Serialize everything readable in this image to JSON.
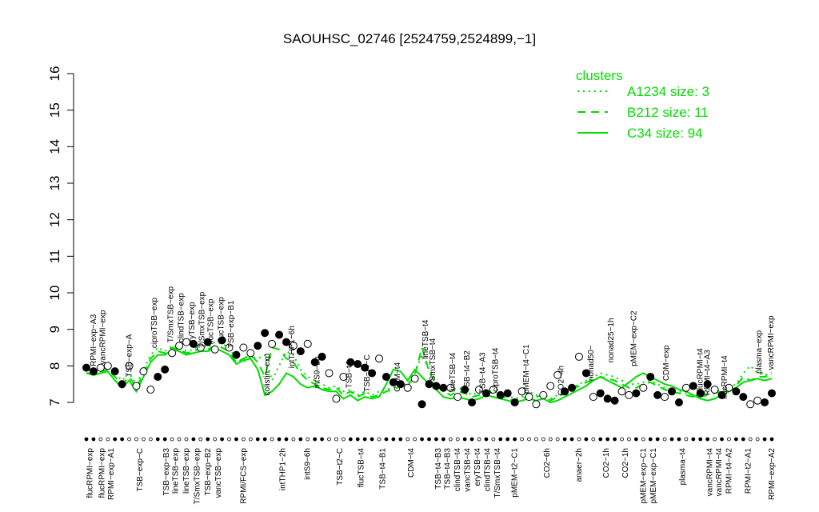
{
  "chart_data": {
    "type": "line",
    "title": "SAOUHSC_02746 [2524759,2524899,−1]",
    "ylim": [
      6.9,
      16.2
    ],
    "yticks": [
      7,
      8,
      9,
      10,
      11,
      12,
      13,
      14,
      15,
      16
    ],
    "legend": {
      "title": "clusters",
      "placement": "top-right",
      "color": "#00dd00",
      "entries": [
        {
          "label": "A1234 size: 3",
          "style": "dotted"
        },
        {
          "label": "B212 size: 11",
          "style": "dashed"
        },
        {
          "label": "C34 size: 94",
          "style": "solid"
        }
      ]
    },
    "x_labels": [
      {
        "pos": 0.5,
        "text": "flucRPMI−exp"
      },
      {
        "pos": 2.2,
        "text": "flucRPMI−exp"
      },
      {
        "pos": 3.5,
        "text": "RPMI−exp−A1"
      },
      {
        "pos": 7.5,
        "text": "TSB−exp−C"
      },
      {
        "pos": 11.2,
        "text": "TSB−exp−B3"
      },
      {
        "pos": 12.5,
        "text": "lineTSB−exp"
      },
      {
        "pos": 14,
        "text": "lineTSB−exp"
      },
      {
        "pos": 15.5,
        "text": "T/SmxTSB−exp"
      },
      {
        "pos": 17,
        "text": "TSB−exp−B2"
      },
      {
        "pos": 18.5,
        "text": "vancTSB−exp"
      },
      {
        "pos": 22,
        "text": "RPMI/FCS−exp"
      },
      {
        "pos": 27.5,
        "text": "intTHP1−2h"
      },
      {
        "pos": 31,
        "text": "intS9−6h"
      },
      {
        "pos": 35.5,
        "text": "TSB−t2−C"
      },
      {
        "pos": 38.5,
        "text": "flucTSB−t4"
      },
      {
        "pos": 41.5,
        "text": "TSB−t4−B1"
      },
      {
        "pos": 45.5,
        "text": "CDM−t4"
      },
      {
        "pos": 49.3,
        "text": "TSB−t4−B3"
      },
      {
        "pos": 50.6,
        "text": "TSB−t4−B3"
      },
      {
        "pos": 52,
        "text": "clindTSB−t4"
      },
      {
        "pos": 53.4,
        "text": "vancTSB−t4"
      },
      {
        "pos": 54.8,
        "text": "eryTSB−t4"
      },
      {
        "pos": 56.2,
        "text": "clindTSB−t4"
      },
      {
        "pos": 57.6,
        "text": "T/SmxTSB−t4"
      },
      {
        "pos": 60,
        "text": "pMEM−t2−C1"
      },
      {
        "pos": 64.5,
        "text": "CO2−6h"
      },
      {
        "pos": 69,
        "text": "anaer−2h"
      },
      {
        "pos": 72.8,
        "text": "CO2−1h"
      },
      {
        "pos": 75.5,
        "text": "CO2−1h"
      },
      {
        "pos": 78,
        "text": "pMEM−exp−C1"
      },
      {
        "pos": 79.4,
        "text": "pMEM−exp−C1"
      },
      {
        "pos": 83.5,
        "text": "plasma−t4"
      },
      {
        "pos": 87.3,
        "text": "vancRPMI−t4"
      },
      {
        "pos": 88.6,
        "text": "vancRPMI−t4"
      },
      {
        "pos": 90,
        "text": "RPMI−t4−A2"
      },
      {
        "pos": 92.7,
        "text": "RPMI−t2−A1"
      },
      {
        "pos": 96,
        "text": "RPMI−exp−A2"
      }
    ],
    "point_labels": [
      {
        "pos": 1,
        "y": 7.9,
        "text": "RPMI−exp−A3"
      },
      {
        "pos": 2.3,
        "y": 7.95,
        "text": "vancRPMI−exp"
      },
      {
        "pos": 6,
        "y": 7.6,
        "text": "TSB−exp−A"
      },
      {
        "pos": 9.5,
        "y": 8.4,
        "text": "ciproTSB−exp"
      },
      {
        "pos": 11.8,
        "y": 8.55,
        "text": "T/SmxTSB−exp"
      },
      {
        "pos": 13.3,
        "y": 8.55,
        "text": "clindTSB−exp"
      },
      {
        "pos": 14.8,
        "y": 8.45,
        "text": "eryTSB−exp"
      },
      {
        "pos": 16.2,
        "y": 8.4,
        "text": "T/SmxTSB−exp"
      },
      {
        "pos": 17.4,
        "y": 8.5,
        "text": "flucTSB−exp"
      },
      {
        "pos": 18.9,
        "y": 8.55,
        "text": "flucTSB−exp"
      },
      {
        "pos": 20.3,
        "y": 8.4,
        "text": "TSB−exp−B1"
      },
      {
        "pos": 25.3,
        "y": 7.1,
        "text": "colistin−exp"
      },
      {
        "pos": 28.8,
        "y": 7.85,
        "text": "intTHP1−6h"
      },
      {
        "pos": 32.3,
        "y": 7.3,
        "text": "intS9−2h"
      },
      {
        "pos": 36.8,
        "y": 7.3,
        "text": "TSB−t4"
      },
      {
        "pos": 39.3,
        "y": 7.2,
        "text": "TSB−t4−C"
      },
      {
        "pos": 43.6,
        "y": 7.2,
        "text": "CDM−t4"
      },
      {
        "pos": 47.5,
        "y": 8.1,
        "text": "lineTSB−t4"
      },
      {
        "pos": 48.5,
        "y": 7.3,
        "text": "T/SmxTSB−t4"
      },
      {
        "pos": 51.3,
        "y": 7.2,
        "text": "lineTSB−t4"
      },
      {
        "pos": 53.3,
        "y": 7.2,
        "text": "TSB−t4−B2"
      },
      {
        "pos": 55.5,
        "y": 7.15,
        "text": "TSB−t4−A3"
      },
      {
        "pos": 57.3,
        "y": 7.2,
        "text": "ciproTSB−t4"
      },
      {
        "pos": 61.6,
        "y": 7.15,
        "text": "pMEM−t4−C1"
      },
      {
        "pos": 66.5,
        "y": 7.1,
        "text": "CO2−4h"
      },
      {
        "pos": 70.7,
        "y": 7.5,
        "text": "nonad50−"
      },
      {
        "pos": 73.5,
        "y": 8.0,
        "text": "nonad25−1h"
      },
      {
        "pos": 76.7,
        "y": 7.9,
        "text": "pMEM−exp−C2"
      },
      {
        "pos": 81.2,
        "y": 7.5,
        "text": "CDM−exp"
      },
      {
        "pos": 86,
        "y": 7.2,
        "text": "flucRPMI−t4"
      },
      {
        "pos": 87,
        "y": 7.1,
        "text": "RPMI−t4−A3"
      },
      {
        "pos": 89.4,
        "y": 7.0,
        "text": "flucRPMI−t4"
      },
      {
        "pos": 94.2,
        "y": 7.7,
        "text": "plasma−exp"
      },
      {
        "pos": 95.9,
        "y": 7.8,
        "text": "vancRPMI−exp"
      }
    ],
    "n_conditions": 97,
    "series": [
      {
        "style": "dotted",
        "values": [
          7.9,
          7.85,
          7.95,
          8.0,
          7.8,
          7.6,
          7.8,
          7.5,
          7.9,
          8.3,
          8.5,
          8.4,
          8.55,
          8.5,
          8.4,
          8.45,
          8.6,
          8.5,
          8.65,
          8.6,
          8.5,
          8.2,
          8.1,
          8.25,
          8.2,
          8.3,
          7.6,
          8.0,
          8.4,
          8.3,
          7.9,
          7.7,
          7.6,
          7.5,
          7.4,
          7.45,
          7.3,
          7.35,
          7.2,
          7.3,
          7.2,
          7.3,
          7.35,
          7.4,
          7.5,
          7.5,
          7.8,
          8.3,
          7.9,
          7.5,
          7.4,
          7.3,
          7.4,
          7.35,
          7.2,
          7.3,
          7.35,
          7.3,
          7.25,
          7.2,
          7.1,
          7.15,
          7.3,
          7.2,
          7.25,
          7.1,
          7.2,
          7.3,
          7.4,
          7.5,
          7.6,
          7.7,
          7.8,
          7.75,
          7.7,
          7.6,
          7.5,
          7.5,
          7.55,
          7.6,
          7.5,
          7.4,
          7.35,
          7.3,
          7.25,
          7.2,
          7.2,
          7.25,
          7.3,
          7.35,
          7.4,
          7.5,
          7.8,
          8.0,
          7.8,
          7.75,
          7.8
        ]
      },
      {
        "style": "dashed",
        "values": [
          7.8,
          7.8,
          7.85,
          7.9,
          7.7,
          7.5,
          7.7,
          7.4,
          7.8,
          8.2,
          8.4,
          8.35,
          8.5,
          8.45,
          8.35,
          8.4,
          8.5,
          8.45,
          8.55,
          8.5,
          8.4,
          8.1,
          8.2,
          8.3,
          8.1,
          7.7,
          8.5,
          8.45,
          8.2,
          8.1,
          7.8,
          7.6,
          7.5,
          7.4,
          7.35,
          7.4,
          7.2,
          7.3,
          7.15,
          7.25,
          7.15,
          7.2,
          7.3,
          7.35,
          7.45,
          7.45,
          7.75,
          8.5,
          7.85,
          7.45,
          7.3,
          7.2,
          7.3,
          7.25,
          7.15,
          7.2,
          7.3,
          7.25,
          7.2,
          7.1,
          7.05,
          7.1,
          7.2,
          7.15,
          7.2,
          7.05,
          7.15,
          7.25,
          7.35,
          7.45,
          7.55,
          7.6,
          7.7,
          7.65,
          7.6,
          7.5,
          7.4,
          7.4,
          7.5,
          7.55,
          7.45,
          7.35,
          7.3,
          7.25,
          7.2,
          7.15,
          7.15,
          7.2,
          7.25,
          7.3,
          7.35,
          7.45,
          7.7,
          7.6,
          7.7,
          7.7,
          7.75
        ]
      },
      {
        "style": "solid",
        "values": [
          7.8,
          7.75,
          7.8,
          7.85,
          7.6,
          7.4,
          7.6,
          7.3,
          7.7,
          8.1,
          8.3,
          8.3,
          8.45,
          8.4,
          8.3,
          8.35,
          8.4,
          8.4,
          8.5,
          8.4,
          8.3,
          8.05,
          8.15,
          8.2,
          7.9,
          7.2,
          7.3,
          7.5,
          7.8,
          7.7,
          7.5,
          7.4,
          7.45,
          7.35,
          7.3,
          7.3,
          7.1,
          7.2,
          7.05,
          7.15,
          7.1,
          7.15,
          7.5,
          7.9,
          7.85,
          7.6,
          7.9,
          7.7,
          7.5,
          7.35,
          7.15,
          7.1,
          7.15,
          7.1,
          7.05,
          7.1,
          7.2,
          7.15,
          7.1,
          7.05,
          7.0,
          7.05,
          7.1,
          7.05,
          7.1,
          7.0,
          7.05,
          7.15,
          7.25,
          7.35,
          7.45,
          7.6,
          7.7,
          7.6,
          7.5,
          7.4,
          7.55,
          7.7,
          7.8,
          7.7,
          7.6,
          7.5,
          7.45,
          7.35,
          7.3,
          7.2,
          7.1,
          7.05,
          7.1,
          7.2,
          7.3,
          7.4,
          7.55,
          7.6,
          7.65,
          7.6,
          7.65
        ]
      }
    ],
    "points": [
      {
        "y": 7.95,
        "f": 1
      },
      {
        "y": 7.85,
        "f": 1
      },
      {
        "y": 7.95,
        "f": 0
      },
      {
        "y": 8.0,
        "f": 0
      },
      {
        "y": 7.85,
        "f": 1
      },
      {
        "y": 7.5,
        "f": 1
      },
      {
        "y": 8.0,
        "f": 0
      },
      {
        "y": 7.45,
        "f": 0
      },
      {
        "y": 7.85,
        "f": 0
      },
      {
        "y": 7.35,
        "f": 0
      },
      {
        "y": 7.7,
        "f": 1
      },
      {
        "y": 7.9,
        "f": 1
      },
      {
        "y": 8.35,
        "f": 0
      },
      {
        "y": 8.55,
        "f": 0
      },
      {
        "y": 8.65,
        "f": 0
      },
      {
        "y": 8.6,
        "f": 1
      },
      {
        "y": 8.5,
        "f": 0
      },
      {
        "y": 8.65,
        "f": 1
      },
      {
        "y": 8.45,
        "f": 0
      },
      {
        "y": 8.7,
        "f": 1
      },
      {
        "y": 8.5,
        "f": 0
      },
      {
        "y": 8.3,
        "f": 1
      },
      {
        "y": 8.5,
        "f": 0
      },
      {
        "y": 8.35,
        "f": 0
      },
      {
        "y": 8.55,
        "f": 1
      },
      {
        "y": 8.9,
        "f": 1
      },
      {
        "y": 8.6,
        "f": 0
      },
      {
        "y": 8.85,
        "f": 1
      },
      {
        "y": 8.65,
        "f": 1
      },
      {
        "y": 8.55,
        "f": 0
      },
      {
        "y": 8.4,
        "f": 1
      },
      {
        "y": 8.6,
        "f": 0
      },
      {
        "y": 8.1,
        "f": 1
      },
      {
        "y": 8.25,
        "f": 1
      },
      {
        "y": 7.8,
        "f": 0
      },
      {
        "y": 7.1,
        "f": 0
      },
      {
        "y": 7.7,
        "f": 0
      },
      {
        "y": 8.1,
        "f": 1
      },
      {
        "y": 8.05,
        "f": 1
      },
      {
        "y": 7.95,
        "f": 1
      },
      {
        "y": 7.8,
        "f": 1
      },
      {
        "y": 8.2,
        "f": 0
      },
      {
        "y": 7.7,
        "f": 1
      },
      {
        "y": 7.55,
        "f": 1
      },
      {
        "y": 7.5,
        "f": 1
      },
      {
        "y": 7.4,
        "f": 0
      },
      {
        "y": 7.65,
        "f": 0
      },
      {
        "y": 6.95,
        "f": 1
      },
      {
        "y": 7.5,
        "f": 1
      },
      {
        "y": 7.45,
        "f": 1
      },
      {
        "y": 7.4,
        "f": 1
      },
      {
        "y": 7.4,
        "f": 0
      },
      {
        "y": 7.15,
        "f": 0
      },
      {
        "y": 7.35,
        "f": 1
      },
      {
        "y": 7.0,
        "f": 1
      },
      {
        "y": 7.35,
        "f": 0
      },
      {
        "y": 7.25,
        "f": 1
      },
      {
        "y": 7.35,
        "f": 0
      },
      {
        "y": 7.2,
        "f": 1
      },
      {
        "y": 7.25,
        "f": 1
      },
      {
        "y": 7.0,
        "f": 1
      },
      {
        "y": 7.3,
        "f": 0
      },
      {
        "y": 7.15,
        "f": 0
      },
      {
        "y": 6.95,
        "f": 0
      },
      {
        "y": 7.2,
        "f": 0
      },
      {
        "y": 7.45,
        "f": 0
      },
      {
        "y": 7.75,
        "f": 0
      },
      {
        "y": 7.3,
        "f": 1
      },
      {
        "y": 7.4,
        "f": 1
      },
      {
        "y": 8.25,
        "f": 0
      },
      {
        "y": 7.8,
        "f": 1
      },
      {
        "y": 7.15,
        "f": 0
      },
      {
        "y": 7.25,
        "f": 1
      },
      {
        "y": 7.1,
        "f": 1
      },
      {
        "y": 7.05,
        "f": 1
      },
      {
        "y": 7.3,
        "f": 0
      },
      {
        "y": 7.2,
        "f": 0
      },
      {
        "y": 7.25,
        "f": 1
      },
      {
        "y": 7.4,
        "f": 0
      },
      {
        "y": 7.7,
        "f": 1
      },
      {
        "y": 7.2,
        "f": 1
      },
      {
        "y": 7.15,
        "f": 0
      },
      {
        "y": 7.3,
        "f": 1
      },
      {
        "y": 7.0,
        "f": 1
      },
      {
        "y": 7.4,
        "f": 0
      },
      {
        "y": 7.45,
        "f": 1
      },
      {
        "y": 7.25,
        "f": 1
      },
      {
        "y": 7.5,
        "f": 1
      },
      {
        "y": 7.35,
        "f": 0
      },
      {
        "y": 7.2,
        "f": 1
      },
      {
        "y": 7.4,
        "f": 0
      },
      {
        "y": 7.3,
        "f": 1
      },
      {
        "y": 7.15,
        "f": 1
      },
      {
        "y": 6.95,
        "f": 0
      },
      {
        "y": 7.05,
        "f": 0
      },
      {
        "y": 7.0,
        "f": 1
      },
      {
        "y": 7.25,
        "f": 1
      }
    ]
  }
}
